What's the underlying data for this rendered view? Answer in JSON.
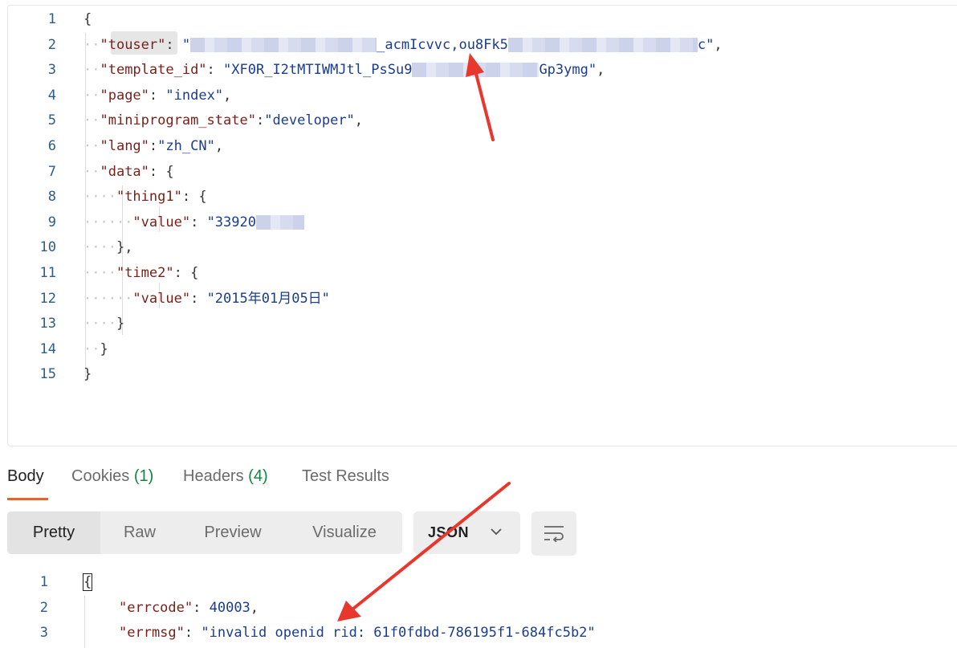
{
  "request": {
    "lines": [
      {
        "n": "1",
        "tokens": [
          [
            "p",
            "{"
          ]
        ]
      },
      {
        "n": "2",
        "tokens": [
          [
            "k",
            "\"touser\""
          ],
          [
            "p",
            ": "
          ],
          [
            "s",
            "\""
          ],
          [
            "blur",
            ""
          ],
          [
            "s",
            "_acmIcvvc,ou8Fk5"
          ],
          [
            "blur2",
            ""
          ],
          [
            "s",
            "c\""
          ],
          [
            "p",
            ","
          ]
        ]
      },
      {
        "n": "3",
        "tokens": [
          [
            "k",
            "\"template_id\""
          ],
          [
            "p",
            ": "
          ],
          [
            "s",
            "\"XF0R_I2tMTIWMJtl_PsSu9"
          ],
          [
            "blur3",
            ""
          ],
          [
            "s",
            "Gp3ymg\""
          ],
          [
            "p",
            ","
          ]
        ]
      },
      {
        "n": "4",
        "tokens": [
          [
            "k",
            "\"page\""
          ],
          [
            "p",
            ": "
          ],
          [
            "s",
            "\"index\""
          ],
          [
            "p",
            ","
          ]
        ]
      },
      {
        "n": "5",
        "tokens": [
          [
            "k",
            "\"miniprogram_state\""
          ],
          [
            "p",
            ":"
          ],
          [
            "s",
            "\"developer\""
          ],
          [
            "p",
            ","
          ]
        ]
      },
      {
        "n": "6",
        "tokens": [
          [
            "k",
            "\"lang\""
          ],
          [
            "p",
            ":"
          ],
          [
            "s",
            "\"zh_CN\""
          ],
          [
            "p",
            ","
          ]
        ]
      },
      {
        "n": "7",
        "tokens": [
          [
            "k",
            "\"data\""
          ],
          [
            "p",
            ": {"
          ]
        ]
      },
      {
        "n": "8",
        "tokens": [
          [
            "k",
            "\"thing1\""
          ],
          [
            "p",
            ": {"
          ]
        ]
      },
      {
        "n": "9",
        "tokens": [
          [
            "k",
            "\"value\""
          ],
          [
            "p",
            ": "
          ],
          [
            "s",
            "\"33920"
          ],
          [
            "blur4",
            ""
          ]
        ]
      },
      {
        "n": "10",
        "tokens": [
          [
            "p",
            "},"
          ]
        ]
      },
      {
        "n": "11",
        "tokens": [
          [
            "k",
            "\"time2\""
          ],
          [
            "p",
            ": {"
          ]
        ]
      },
      {
        "n": "12",
        "tokens": [
          [
            "k",
            "\"value\""
          ],
          [
            "p",
            ": "
          ],
          [
            "s",
            "\"2015年01月05日\""
          ]
        ]
      },
      {
        "n": "13",
        "tokens": [
          [
            "p",
            "}"
          ]
        ]
      },
      {
        "n": "14",
        "tokens": [
          [
            "p",
            "}"
          ]
        ]
      },
      {
        "n": "15",
        "tokens": [
          [
            "p",
            "}"
          ]
        ]
      }
    ]
  },
  "response_tabs": {
    "body": "Body",
    "cookies": "Cookies",
    "cookies_count": "(1)",
    "headers": "Headers",
    "headers_count": "(4)",
    "test_results": "Test Results"
  },
  "view_modes": {
    "pretty": "Pretty",
    "raw": "Raw",
    "preview": "Preview",
    "visualize": "Visualize"
  },
  "format_select": {
    "selected": "JSON"
  },
  "response": {
    "lines": [
      {
        "n": "1",
        "tokens": [
          [
            "p",
            "{"
          ]
        ]
      },
      {
        "n": "2",
        "tokens": [
          [
            "k",
            "\"errcode\""
          ],
          [
            "p",
            ": "
          ],
          [
            "n",
            "40003"
          ],
          [
            "p",
            ","
          ]
        ]
      },
      {
        "n": "3",
        "tokens": [
          [
            "k",
            "\"errmsg\""
          ],
          [
            "p",
            ": "
          ],
          [
            "s",
            "\"invalid openid rid: 61f0fdbd-786195f1-684fc5b2\""
          ]
        ]
      }
    ]
  },
  "colors": {
    "key": "#7a1f17",
    "string": "#1a3c91",
    "line_number": "#2b5c8a",
    "active_tab_underline": "#e8622c",
    "count_badge": "#0a8a3a",
    "annotation_arrow": "#e8372c"
  },
  "icons": {
    "format_chevron": "chevron-down-icon",
    "wrap": "word-wrap-icon",
    "annotation": "red-arrow-icon"
  }
}
